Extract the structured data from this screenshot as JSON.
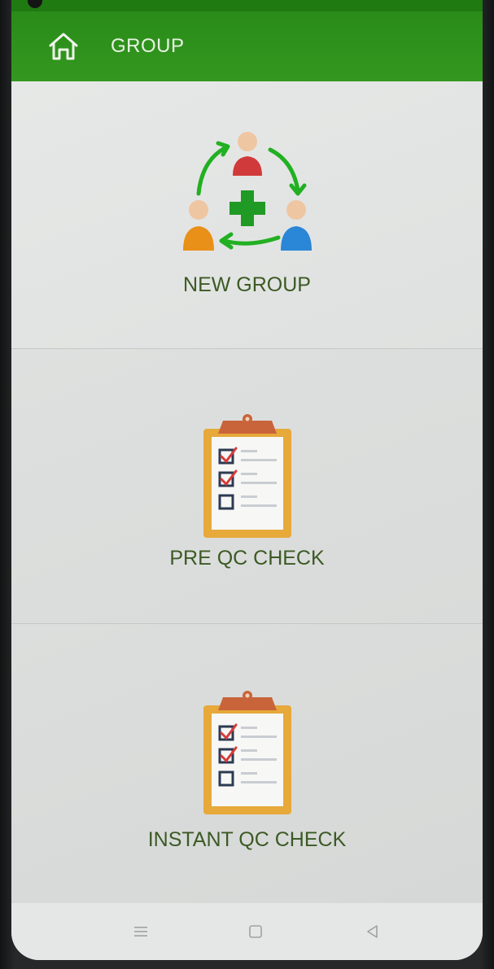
{
  "app_bar": {
    "title": "GROUP",
    "home_icon": "home-icon"
  },
  "tiles": [
    {
      "label": "NEW GROUP",
      "icon": "new-group-icon"
    },
    {
      "label": "PRE QC CHECK",
      "icon": "clipboard-checklist-icon"
    },
    {
      "label": "INSTANT QC CHECK",
      "icon": "clipboard-checklist-icon"
    }
  ],
  "nav_bar": {
    "menu_icon": "menu-icon",
    "home_icon": "square-home-icon",
    "back_icon": "triangle-back-icon"
  },
  "colors": {
    "app_bar": "#2a8b19",
    "label_text": "#3c5a24",
    "arrow_green": "#22b022",
    "clipboard_frame": "#e6a93a",
    "clipboard_clip": "#c9643a",
    "check_red": "#d83a3a"
  }
}
